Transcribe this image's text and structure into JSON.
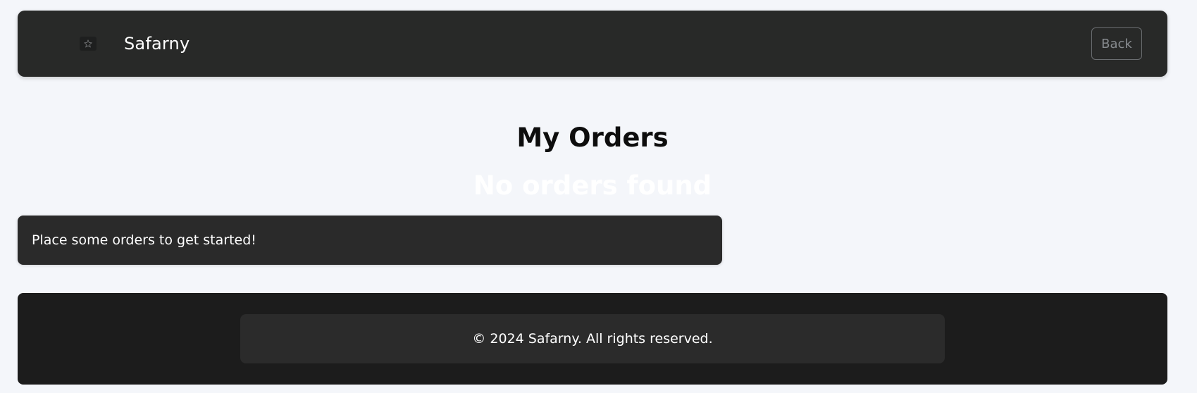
{
  "navbar": {
    "brand": "Safarny",
    "logo_icon": "logo-icon",
    "back_label": "Back"
  },
  "main": {
    "title": "My Orders",
    "empty_heading": "No orders found",
    "empty_message": "Place some orders to get started!"
  },
  "footer": {
    "copyright": "© 2024 Safarny. All rights reserved."
  },
  "colors": {
    "page_background": "#f4f6fa",
    "navbar_background": "#282928",
    "card_background": "#2a2a2a",
    "footer_background": "#1c1c1c"
  }
}
